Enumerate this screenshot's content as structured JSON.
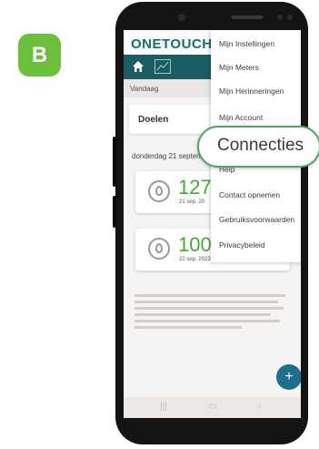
{
  "step_badge": "B",
  "app": {
    "logo": "ONETOUCH",
    "date_strip": "Vandaag",
    "goals_label": "Doelen",
    "day_header": "donderdag 21 septem",
    "readings": [
      {
        "value": "127",
        "time": "21 sep. 20"
      },
      {
        "value": "100",
        "time": "22 sep. 2023, 21:38"
      }
    ],
    "fab_symbol": "+"
  },
  "menu": {
    "items": [
      "Mijn Instellingen",
      "Mijn Meters",
      "Mijn Herinneringen",
      "Mijn Account",
      "Help",
      "Contact opnemen",
      "Gebruiksvoorwaarden",
      "Privacybeleid"
    ],
    "highlighted_item": "Connecties"
  },
  "colors": {
    "brand": "#156f6c",
    "nav_bar": "#1b5d62",
    "reading_value": "#4aa832",
    "badge": "#6bbf3b",
    "highlight_border": "#4da861",
    "fab": "#1d6f8d"
  }
}
